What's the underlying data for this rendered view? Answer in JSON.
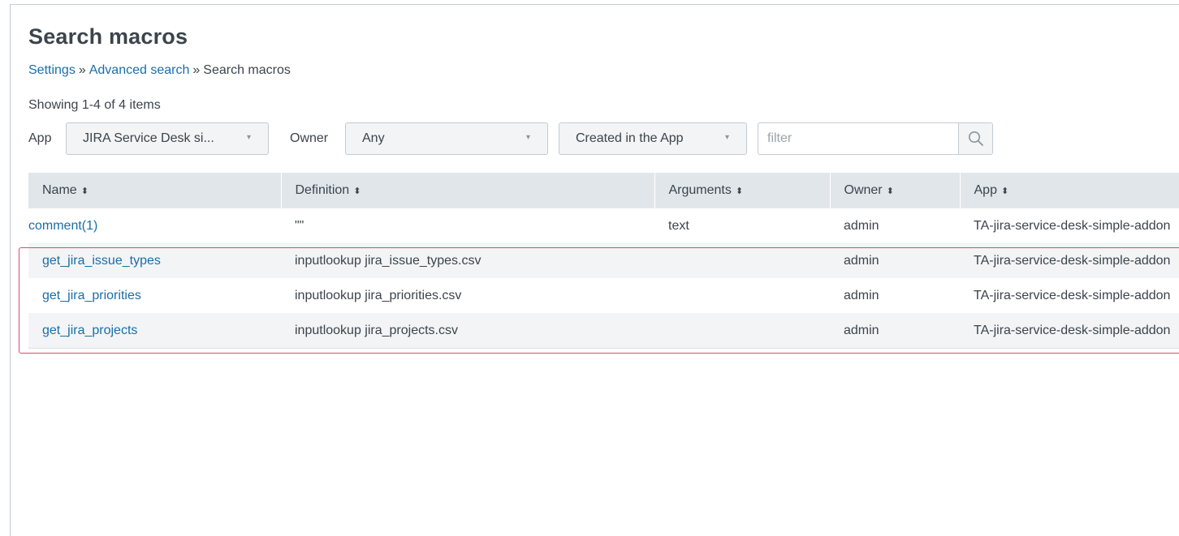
{
  "page": {
    "title": "Search macros",
    "breadcrumb": [
      "Settings",
      "Advanced search",
      "Search macros"
    ],
    "breadcrumb_sep": "»",
    "count_text": "Showing 1-4 of 4 items"
  },
  "filters": {
    "app_label": "App",
    "app_value": "JIRA Service Desk si...",
    "owner_label": "Owner",
    "owner_value": "Any",
    "visibility_value": "Created in the App",
    "search_placeholder": "filter",
    "caret": "▾"
  },
  "table": {
    "sort_glyph": "⬍",
    "columns": [
      "Name",
      "Definition",
      "Arguments",
      "Owner",
      "App"
    ],
    "rows": [
      {
        "name": "comment(1)",
        "definition": "\"\"",
        "arguments": "text",
        "owner": "admin",
        "app": "TA-jira-service-desk-simple-addon"
      },
      {
        "name": "get_jira_issue_types",
        "definition": "inputlookup jira_issue_types.csv",
        "arguments": "",
        "owner": "admin",
        "app": "TA-jira-service-desk-simple-addon"
      },
      {
        "name": "get_jira_priorities",
        "definition": "inputlookup jira_priorities.csv",
        "arguments": "",
        "owner": "admin",
        "app": "TA-jira-service-desk-simple-addon"
      },
      {
        "name": "get_jira_projects",
        "definition": "inputlookup jira_projects.csv",
        "arguments": "",
        "owner": "admin",
        "app": "TA-jira-service-desk-simple-addon"
      }
    ]
  },
  "icons": {
    "search": "search-icon"
  },
  "colors": {
    "link": "#1a6ea8",
    "highlight": "#e8456b",
    "header_bg": "#e1e6eb"
  }
}
